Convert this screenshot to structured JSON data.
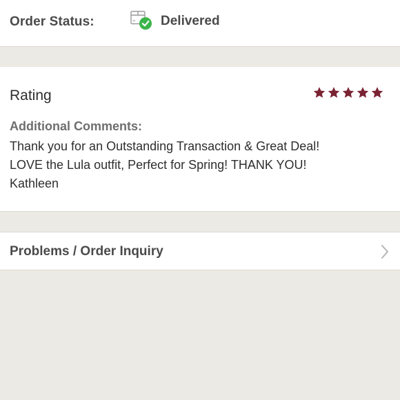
{
  "order_status": {
    "label": "Order Status:",
    "value": "Delivered",
    "icon": "package-delivered-icon"
  },
  "rating": {
    "title": "Rating",
    "stars": 5,
    "max_stars": 5,
    "star_color": "#7A2333",
    "comments_label": "Additional Comments:",
    "comments_text": "Thank you for an Outstanding Transaction & Great Deal!\nLOVE the Lula outfit, Perfect for Spring! THANK YOU!\nKathleen"
  },
  "problems": {
    "label": "Problems / Order Inquiry",
    "icon": "chevron-right-icon"
  },
  "colors": {
    "background": "#ECEAE5",
    "card": "#FFFFFF",
    "check_green": "#3BB54A"
  }
}
